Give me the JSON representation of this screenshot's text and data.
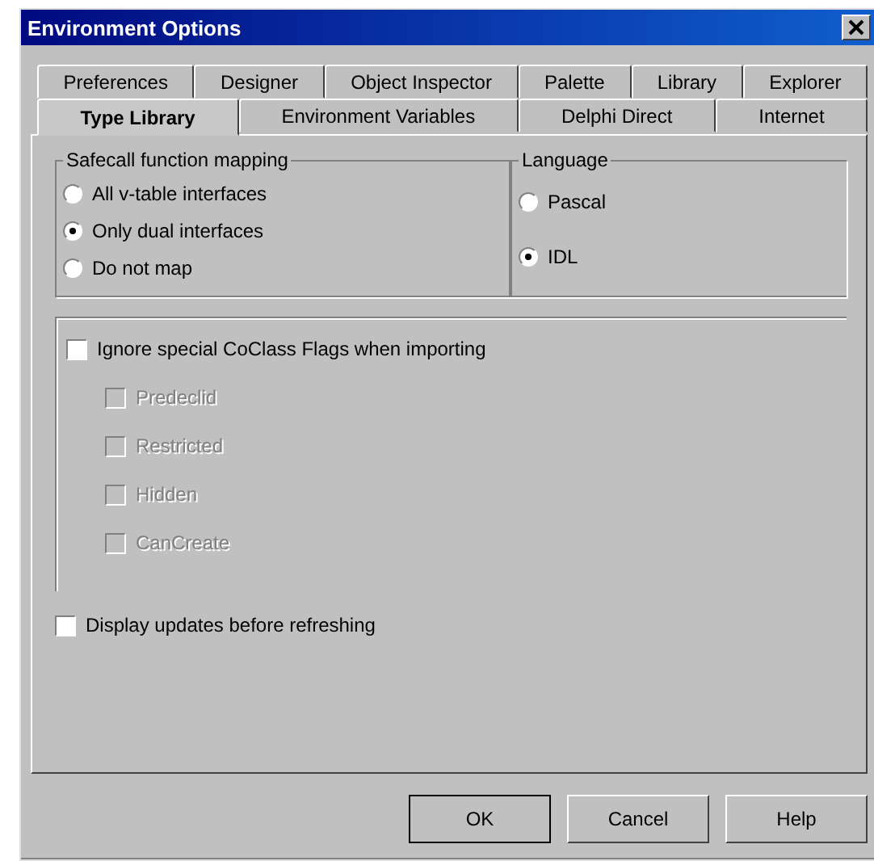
{
  "window": {
    "title": "Environment Options"
  },
  "tab_rows": [
    [
      {
        "label": "Preferences",
        "selected": false
      },
      {
        "label": "Designer",
        "selected": false
      },
      {
        "label": "Object Inspector",
        "selected": false
      },
      {
        "label": "Palette",
        "selected": false
      },
      {
        "label": "Library",
        "selected": false
      },
      {
        "label": "Explorer",
        "selected": false
      }
    ],
    [
      {
        "label": "Type Library",
        "selected": true
      },
      {
        "label": "Environment Variables",
        "selected": false
      },
      {
        "label": "Delphi Direct",
        "selected": false
      },
      {
        "label": "Internet",
        "selected": false
      }
    ]
  ],
  "safecall_group": {
    "title": "Safecall function mapping",
    "options": [
      {
        "label": "All v-table interfaces",
        "selected": false
      },
      {
        "label": "Only dual interfaces",
        "selected": true
      },
      {
        "label": "Do not map",
        "selected": false
      }
    ]
  },
  "language_group": {
    "title": "Language",
    "options": [
      {
        "label": "Pascal",
        "selected": false
      },
      {
        "label": "IDL",
        "selected": true
      }
    ]
  },
  "ignore_flags": {
    "label": "Ignore special CoClass Flags when importing",
    "checked": false,
    "disabled": false,
    "children": [
      {
        "label": "Predeclid",
        "checked": false,
        "disabled": true
      },
      {
        "label": "Restricted",
        "checked": false,
        "disabled": true
      },
      {
        "label": "Hidden",
        "checked": false,
        "disabled": true
      },
      {
        "label": "CanCreate",
        "checked": false,
        "disabled": true
      }
    ]
  },
  "display_updates": {
    "label": "Display updates before refreshing",
    "checked": false,
    "disabled": false
  },
  "buttons": [
    {
      "label": "OK",
      "default": true
    },
    {
      "label": "Cancel",
      "default": false
    },
    {
      "label": "Help",
      "default": false
    }
  ]
}
